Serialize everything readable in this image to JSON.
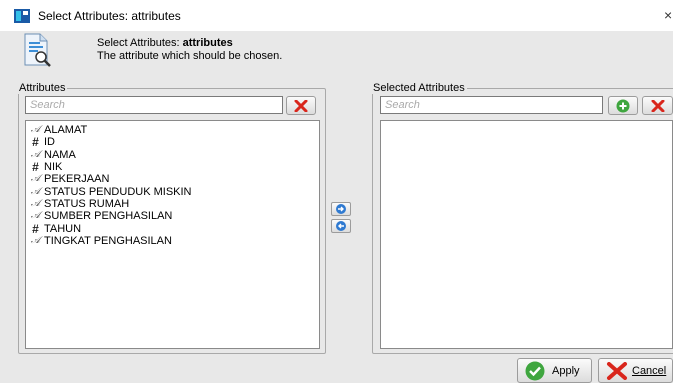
{
  "window": {
    "title": "Select Attributes: attributes",
    "close_glyph": "×"
  },
  "header": {
    "title_prefix": "Select Attributes: ",
    "title_bold": "attributes",
    "description": "The attribute which should be chosen.",
    "icon": "document-search-icon"
  },
  "left_panel": {
    "legend": "Attributes",
    "search_placeholder": "Search",
    "items": [
      {
        "type": "nominal",
        "type_glyph": "𝒜",
        "label": "ALAMAT"
      },
      {
        "type": "numeric",
        "type_glyph": "#",
        "label": "ID"
      },
      {
        "type": "nominal",
        "type_glyph": "𝒜",
        "label": "NAMA"
      },
      {
        "type": "numeric",
        "type_glyph": "#",
        "label": "NIK"
      },
      {
        "type": "nominal",
        "type_glyph": "𝒜",
        "label": "PEKERJAAN"
      },
      {
        "type": "nominal",
        "type_glyph": "𝒜",
        "label": "STATUS PENDUDUK MISKIN"
      },
      {
        "type": "nominal",
        "type_glyph": "𝒜",
        "label": "STATUS RUMAH"
      },
      {
        "type": "nominal",
        "type_glyph": "𝒜",
        "label": "SUMBER PENGHASILAN"
      },
      {
        "type": "numeric",
        "type_glyph": "#",
        "label": "TAHUN"
      },
      {
        "type": "nominal",
        "type_glyph": "𝒜",
        "label": "TINGKAT PENGHASILAN"
      }
    ]
  },
  "right_panel": {
    "legend": "Selected Attributes",
    "search_placeholder": "Search",
    "items": []
  },
  "footer": {
    "apply_label": "Apply",
    "cancel_label": "Cancel"
  },
  "colors": {
    "green": "#3fa63f",
    "red": "#d9261c",
    "blue": "#2f7ad1"
  }
}
